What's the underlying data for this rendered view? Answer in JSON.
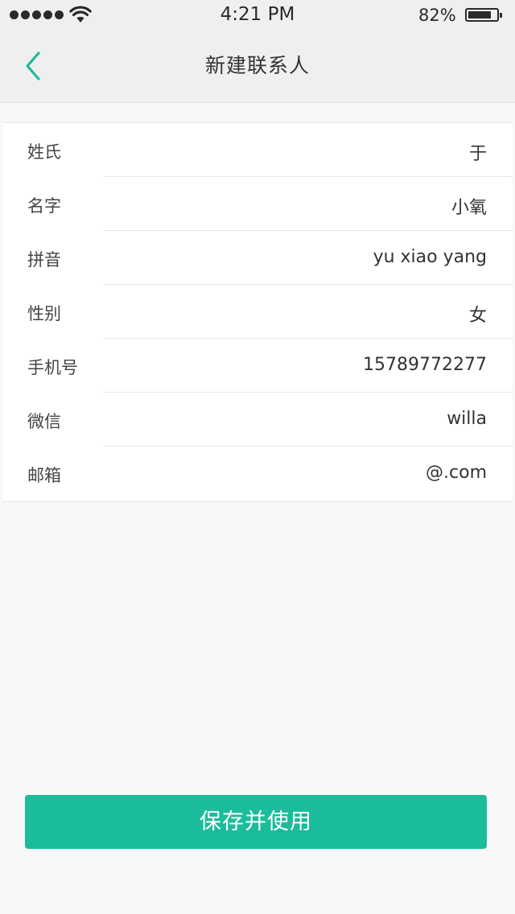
{
  "status_bar": {
    "time": "4:21 PM",
    "battery_percent": "82%",
    "battery_level": 0.82,
    "signal_bars": 5
  },
  "nav": {
    "title": "新建联系人",
    "back_icon": "chevron-left-icon"
  },
  "colors": {
    "accent": "#1bbc9b",
    "header_bg": "#efefef",
    "page_bg": "#f8f8f8"
  },
  "form": {
    "fields": [
      {
        "label": "姓氏",
        "value": "于"
      },
      {
        "label": "名字",
        "value": "小氧"
      },
      {
        "label": "拼音",
        "value": "yu xiao yang"
      },
      {
        "label": "性别",
        "value": "女"
      },
      {
        "label": "手机号",
        "value": "15789772277"
      },
      {
        "label": "微信",
        "value": "willa"
      },
      {
        "label": "邮箱",
        "value": "@.com"
      }
    ]
  },
  "actions": {
    "save_label": "保存并使用"
  }
}
